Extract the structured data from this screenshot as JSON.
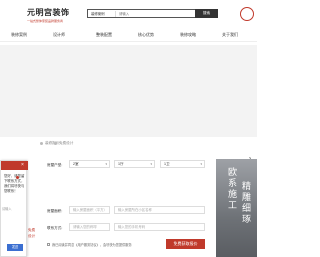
{
  "header": {
    "logo_title": "元明宫装饰",
    "logo_subtitle": "一站式整体家装品牌服务商",
    "search": {
      "category": "装修案例",
      "placeholder": "请输入",
      "button": "搜索"
    },
    "seal_text": "元明"
  },
  "nav": {
    "items": [
      "装修案例",
      "设计师",
      "整装配置",
      "核心优势",
      "装修攻略",
      "关于我们"
    ]
  },
  "tabs": {
    "items": [
      "装修报价",
      "免费设计"
    ]
  },
  "form": {
    "house_type_label": "房屋户型:",
    "room_select": "2室",
    "hall_select": "1厅",
    "bath_select": "1卫",
    "area_label": "房屋面积:",
    "area_placeholder": "输入房屋面积（平方）",
    "community_placeholder": "输入房屋所在小区名称",
    "contact_label": "联系方式:",
    "name_placeholder": "请输入您的称呼",
    "phone_placeholder": "输入您的手机号码",
    "agree_text": "我已阅读并同意《用户服务协议》，会尽快为您提供服务",
    "quote_button": "免费获取报价"
  },
  "photo": {
    "text_left": "欧系施工",
    "text_right": "精雕细琢"
  },
  "chat": {
    "close": "×",
    "message": "您好，请您留下联系方式，我们将尽快与您联系！",
    "input_placeholder": "请输入",
    "send_button": "发送",
    "side_text": "免费\n设计"
  },
  "colors": {
    "brand_red": "#c0392b",
    "send_blue": "#3b6fd1",
    "dark": "#333333"
  }
}
